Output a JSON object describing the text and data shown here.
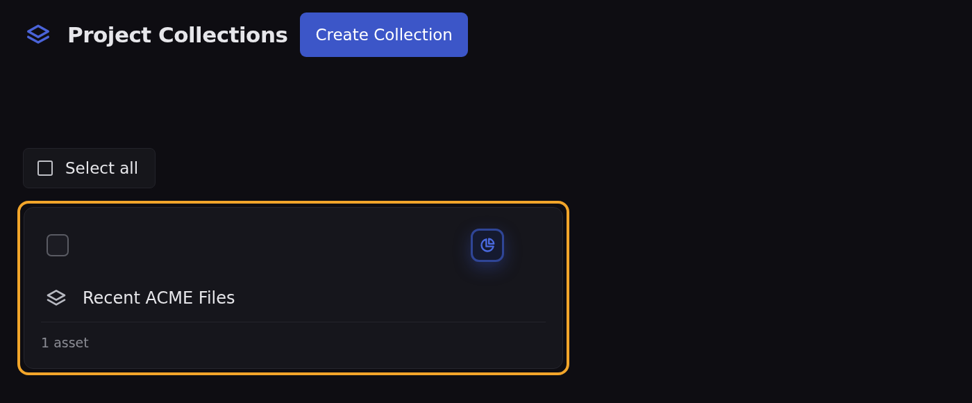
{
  "header": {
    "title": "Project Collections",
    "create_button": "Create Collection"
  },
  "select_all": {
    "label": "Select all",
    "checked": false
  },
  "collections": [
    {
      "name": "Recent ACME Files",
      "asset_count": "1 asset",
      "checked": false,
      "focused": true
    }
  ]
}
